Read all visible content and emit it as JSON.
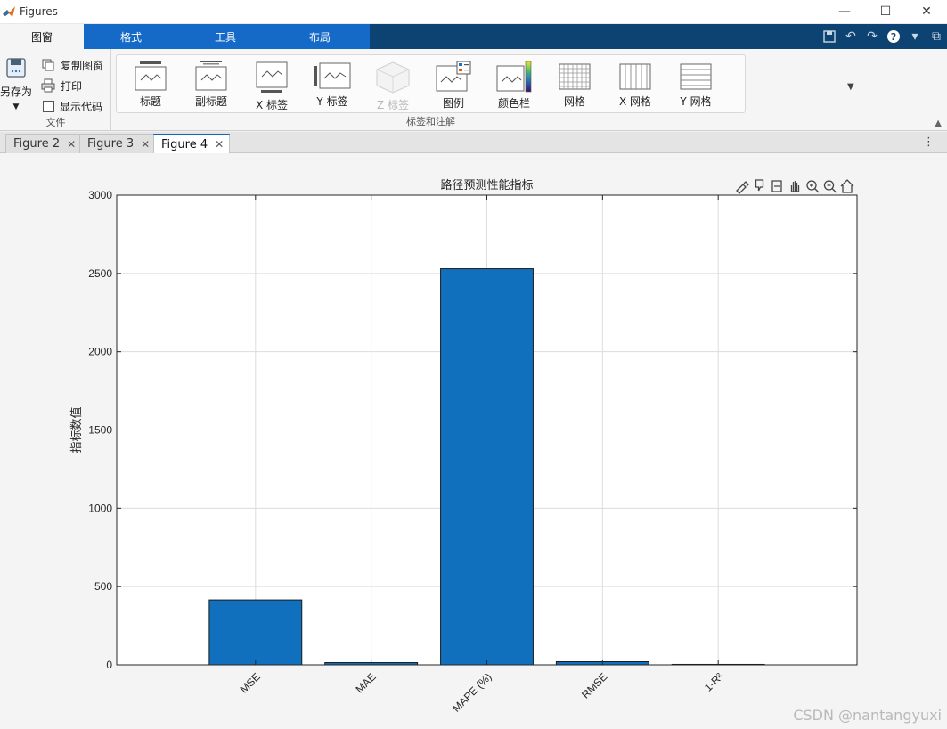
{
  "window": {
    "title": "Figures"
  },
  "ribbon_tabs": [
    {
      "label": "图窗",
      "active": true
    },
    {
      "label": "格式",
      "active": false
    },
    {
      "label": "工具",
      "active": false
    },
    {
      "label": "布局",
      "active": false
    }
  ],
  "file_group": {
    "save_as": "另存为",
    "copy_figure": "复制图窗",
    "print": "打印",
    "show_code": "显示代码",
    "label": "文件"
  },
  "labels_group": {
    "label": "标签和注解",
    "items": [
      {
        "label": "标题",
        "icon": "title-icon",
        "enabled": true
      },
      {
        "label": "副标题",
        "icon": "subtitle-icon",
        "enabled": true
      },
      {
        "label": "X 标签",
        "icon": "xlabel-icon",
        "enabled": true
      },
      {
        "label": "Y 标签",
        "icon": "ylabel-icon",
        "enabled": true
      },
      {
        "label": "Z 标签",
        "icon": "zlabel-icon",
        "enabled": false
      },
      {
        "label": "图例",
        "icon": "legend-icon",
        "enabled": true
      },
      {
        "label": "颜色栏",
        "icon": "colorbar-icon",
        "enabled": true
      },
      {
        "label": "网格",
        "icon": "grid-icon",
        "enabled": true
      },
      {
        "label": "X 网格",
        "icon": "xgrid-icon",
        "enabled": true
      },
      {
        "label": "Y 网格",
        "icon": "ygrid-icon",
        "enabled": true
      }
    ]
  },
  "doc_tabs": [
    {
      "label": "Figure 2",
      "active": false
    },
    {
      "label": "Figure 3",
      "active": false
    },
    {
      "label": "Figure 4",
      "active": true
    }
  ],
  "colors": {
    "ribbon_blue": "#1569c7",
    "ribbon_dark": "#0c4373",
    "bar_fill": "#1170be",
    "bar_edge": "#1a1a1a"
  },
  "chart_data": {
    "type": "bar",
    "title": "路径预测性能指标",
    "xlabel": "",
    "ylabel": "指标数值",
    "categories": [
      "MSE",
      "MAE",
      "MAPE (%)",
      "RMSE",
      "1-R²"
    ],
    "values": [
      415,
      14,
      2530,
      20,
      3
    ],
    "ylim": [
      0,
      3000
    ],
    "yticks": [
      0,
      500,
      1000,
      1500,
      2000,
      2500,
      3000
    ],
    "grid": true,
    "legend": "none"
  },
  "watermark": "CSDN @nantangyuxi"
}
